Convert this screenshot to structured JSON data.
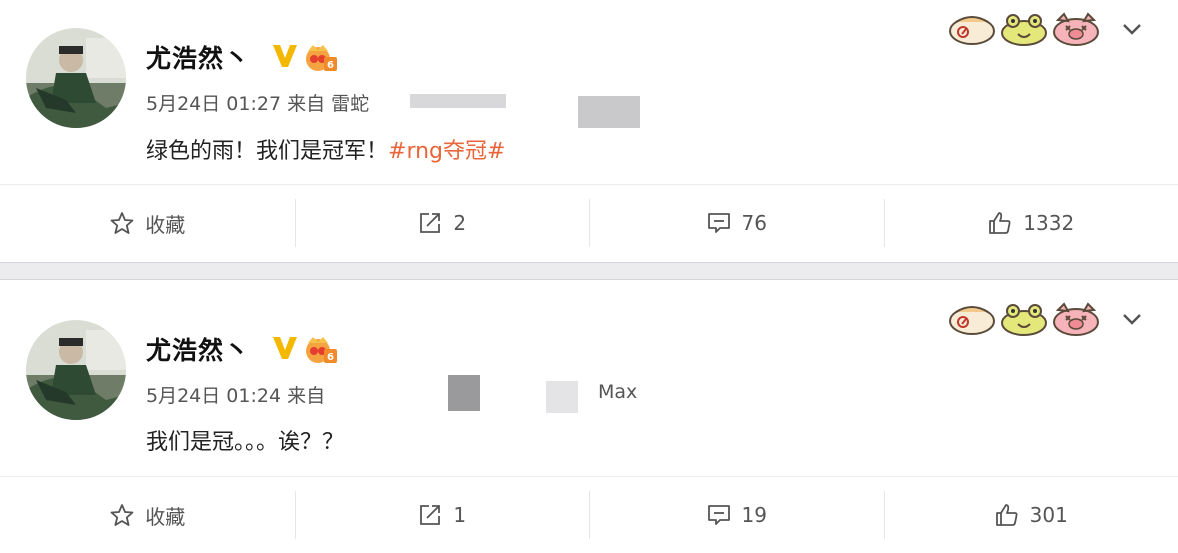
{
  "posts": [
    {
      "username": "尤浩然丶",
      "meta": "5月24日 01:27 来自 雷蛇",
      "content": "绿色的雨！我们是冠军！",
      "hashtag": "#rng夺冠#",
      "actions": {
        "favorite_label": "收藏",
        "repost_count": "2",
        "comment_count": "76",
        "like_count": "1332"
      }
    },
    {
      "username": "尤浩然丶",
      "meta": "5月24日 01:24 来自",
      "meta_suffix": "Max",
      "content": "我们是冠。。。诶？？",
      "hashtag": "",
      "actions": {
        "favorite_label": "收藏",
        "repost_count": "1",
        "comment_count": "19",
        "like_count": "301"
      }
    }
  ],
  "icons": {
    "verified": "verified-v-icon",
    "badge": "crown-level-badge-icon",
    "reactions": [
      "hamster-face-icon",
      "frog-face-icon",
      "pig-face-icon"
    ],
    "expand": "chevron-down-icon",
    "favorite": "star-icon",
    "repost": "repost-icon",
    "comment": "comment-icon",
    "like": "thumbs-up-icon"
  },
  "colors": {
    "verified": "#f5b800",
    "hashtag": "#e8663a",
    "separator": "#ececef",
    "text": "#222222"
  }
}
